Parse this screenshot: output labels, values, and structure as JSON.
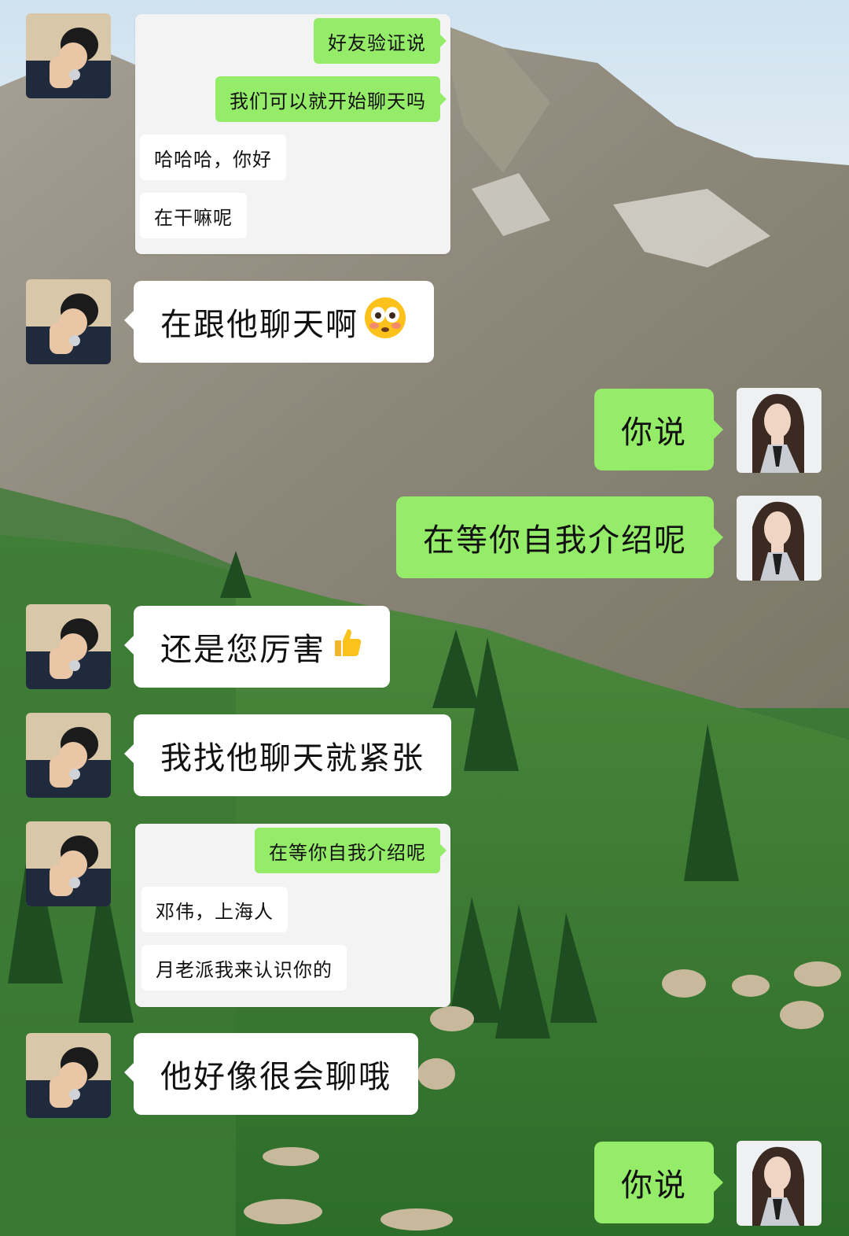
{
  "chat": {
    "sent_avatar_label": "woman-avatar",
    "received_avatar_label": "man-avatar",
    "colors": {
      "sent_bubble": "#95ec69",
      "received_bubble": "#ffffff",
      "card": "#f3f3f3"
    },
    "card1": {
      "lines": [
        {
          "side": "sent",
          "text": "好友验证说"
        },
        {
          "side": "sent",
          "text": "我们可以就开始聊天吗"
        },
        {
          "side": "received",
          "text": "哈哈哈，你好"
        },
        {
          "side": "received",
          "text": "在干嘛呢"
        }
      ]
    },
    "m1": "在跟他聊天啊",
    "m2": "你说",
    "m3": "在等你自我介绍呢",
    "m4": "还是您厉害",
    "m5": "我找他聊天就紧张",
    "card2": {
      "lines": [
        {
          "side": "sent",
          "text": "在等你自我介绍呢"
        },
        {
          "side": "received",
          "text": "邓伟，上海人"
        },
        {
          "side": "received",
          "text": "月老派我来认识你的"
        }
      ]
    },
    "m6": "他好像很会聊哦",
    "m7": "你说"
  }
}
